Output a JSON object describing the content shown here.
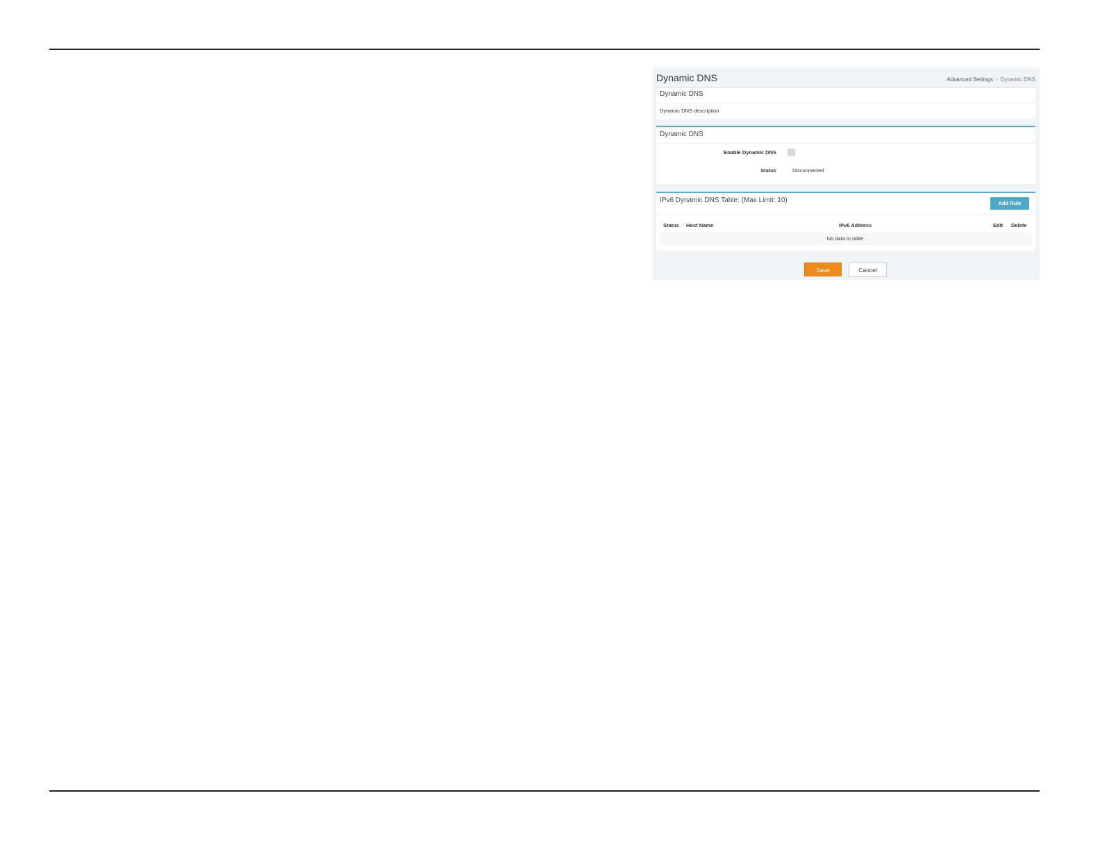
{
  "page": {
    "title": "Dynamic DNS",
    "breadcrumb": {
      "parent": "Advanced Settings",
      "separator": ">",
      "current": "Dynamic DNS"
    }
  },
  "intro_card": {
    "title": "Dynamic DNS",
    "description": "Dynamic DNS description"
  },
  "settings_card": {
    "title": "Dynamic DNS",
    "enable_label": "Enable Dynamic DNS",
    "enable_checked": false,
    "status_label": "Status",
    "status_value": "Disconnected"
  },
  "ipv6_table": {
    "title": "IPv6 Dynamic DNS Table: (Max Limit: 10)",
    "add_button_label": "Add Rule",
    "columns": [
      "Status",
      "Host Name",
      "IPv6 Address",
      "Edit",
      "Delete"
    ],
    "empty_message": "No data in table."
  },
  "actions": {
    "save_label": "Save",
    "cancel_label": "Cancel"
  },
  "colors": {
    "accent": "#4fb1d1",
    "save": "#ec8a1b",
    "add_rule": "#4fa8c8",
    "panel_bg": "#f1f4f7"
  }
}
